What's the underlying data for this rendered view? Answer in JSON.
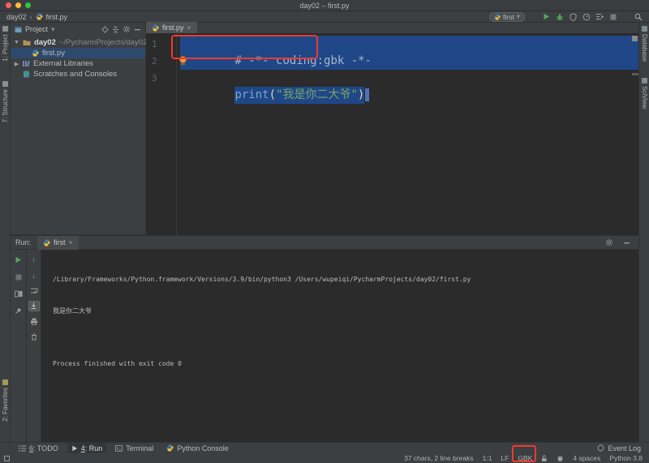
{
  "window": {
    "title": "day02 – first.py"
  },
  "navbar": {
    "breadcrumb_project": "day02",
    "breadcrumb_separator": "›",
    "breadcrumb_file": "first.py",
    "run_config": "first",
    "run_config_arrow": "▾"
  },
  "project_panel": {
    "title": "Project",
    "title_arrow": "▾",
    "tree": [
      {
        "label": "day02",
        "path": "~/PycharmProjects/day02"
      },
      {
        "label": "first.py"
      },
      {
        "label": "External Libraries"
      },
      {
        "label": "Scratches and Consoles"
      }
    ]
  },
  "editor": {
    "tab_label": "first.py",
    "tab_close": "×",
    "line_numbers": [
      "1",
      "2",
      "3"
    ],
    "code_line1": "# -*- coding:gbk -*-",
    "code_line3_fn": "print",
    "code_line3_open": "(",
    "code_line3_str": "\"我是你二大爷\"",
    "code_line3_close": ")"
  },
  "run_panel": {
    "label": "Run:",
    "tab_label": "first",
    "tab_close": "×",
    "console_line1": "/Library/Frameworks/Python.framework/Versions/3.9/bin/python3 /Users/wupeiqi/PycharmProjects/day02/first.py",
    "console_line2": "我是你二大爷",
    "console_line3": "",
    "console_line4": "Process finished with exit code 0"
  },
  "left_strip": {
    "project": "1: Project",
    "structure": "7: Structure",
    "favorites": "2: Favorites"
  },
  "right_strip": {
    "database": "Database",
    "sciview": "SciView"
  },
  "bottom_bar": {
    "todo_mnemonic": "6",
    "todo_rest": ": TODO",
    "run_mnemonic": "4",
    "run_rest": ": Run",
    "terminal": "Terminal",
    "python_console": "Python Console",
    "event_log": "Event Log"
  },
  "status_bar": {
    "stats": "37 chars, 2 line breaks",
    "caret": "1:1",
    "line_sep": "LF",
    "encoding": "GBK",
    "indent": "4 spaces",
    "interpreter": "Python 3.8"
  },
  "colors": {
    "selection_blue": "#1f4788",
    "annotation_red": "#ee3a2e",
    "string_green": "#7aa564",
    "function_blue": "#7aa4c9",
    "run_green": "#57a35a",
    "traffic_red": "#ff5f57",
    "traffic_yellow": "#febc2e",
    "traffic_green": "#2ac840"
  }
}
